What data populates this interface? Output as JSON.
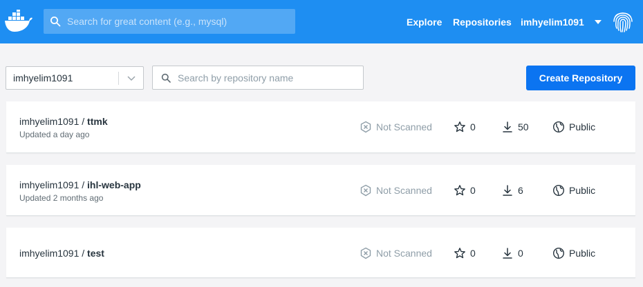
{
  "header": {
    "search_placeholder": "Search for great content (e.g., mysql)",
    "nav": {
      "explore": "Explore",
      "repositories": "Repositories",
      "username": "imhyelim1091"
    },
    "brand_color": "#1e8ef2"
  },
  "toolbar": {
    "namespace": "imhyelim1091",
    "repo_search_placeholder": "Search by repository name",
    "create_label": "Create Repository",
    "create_color": "#0b74f1"
  },
  "repositories": [
    {
      "owner": "imhyelim1091 / ",
      "name": "ttmk",
      "updated": "Updated a day ago",
      "scan": "Not Scanned",
      "stars": "0",
      "pulls": "50",
      "visibility": "Public"
    },
    {
      "owner": "imhyelim1091 / ",
      "name": "ihl-web-app",
      "updated": "Updated 2 months ago",
      "scan": "Not Scanned",
      "stars": "0",
      "pulls": "6",
      "visibility": "Public"
    },
    {
      "owner": "imhyelim1091 / ",
      "name": "test",
      "updated": "",
      "scan": "Not Scanned",
      "stars": "0",
      "pulls": "0",
      "visibility": "Public"
    }
  ],
  "icons": {
    "logo": "docker-whale-icon",
    "search": "search-icon",
    "fingerprint": "fingerprint-icon",
    "scan": "shield-x-icon",
    "star": "star-icon",
    "pulls": "download-icon",
    "visibility": "globe-icon"
  }
}
